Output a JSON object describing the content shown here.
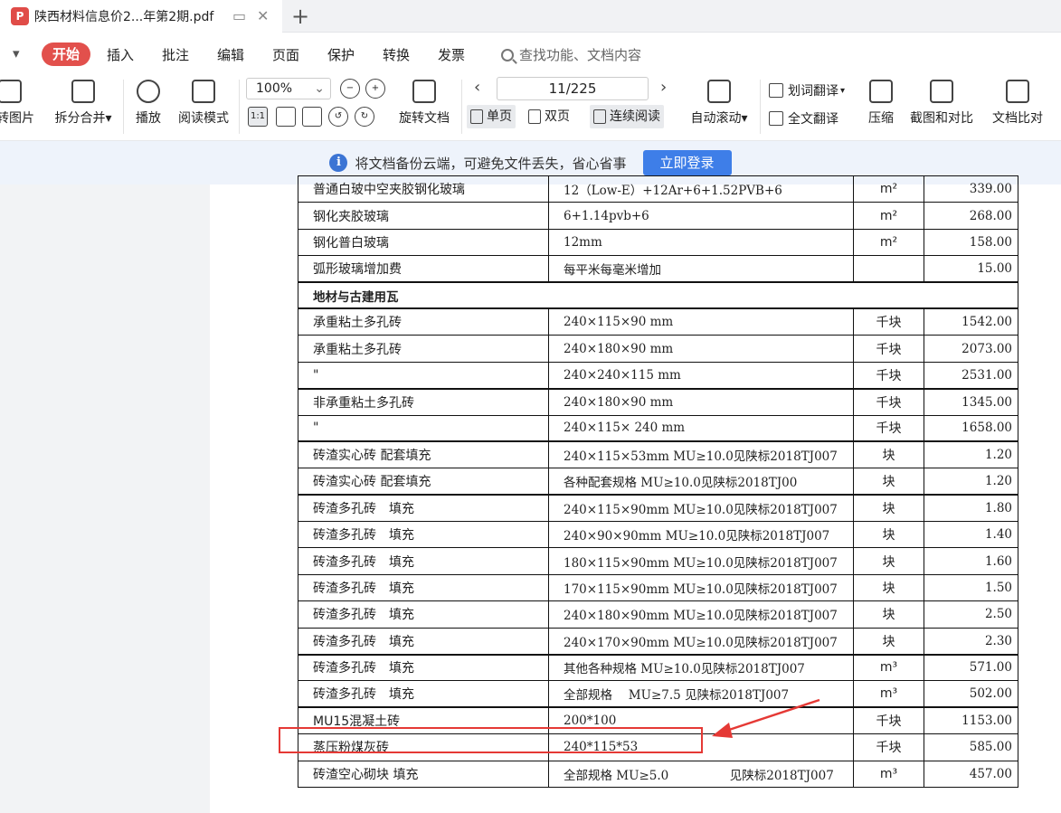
{
  "tab": {
    "title": "陕西材料信息价2...年第2期.pdf",
    "pdf_badge": "P"
  },
  "menu": {
    "dropdown": "▾",
    "active": "开始",
    "items": [
      "插入",
      "批注",
      "编辑",
      "页面",
      "保护",
      "转换",
      "发票"
    ],
    "search_placeholder": "查找功能、文档内容"
  },
  "toolbar": {
    "to_image": "转图片",
    "split_merge": "拆分合并",
    "play": "播放",
    "read_mode": "阅读模式",
    "zoom": "100%",
    "rotate": "旋转文档",
    "page_indicator": "11/225",
    "single_page": "单页",
    "double_page": "双页",
    "continuous": "连续阅读",
    "auto_scroll": "自动滚动",
    "word_translate": "划词翻译",
    "full_translate": "全文翻译",
    "compress": "压缩",
    "screenshot_compare": "截图和对比",
    "doc_compare": "文档比对"
  },
  "notice": {
    "text": "将文档备份云端，可避免文件丢失，省心省事",
    "button": "立即登录"
  },
  "table": {
    "rows": [
      [
        "普通白玻中空夹胶钢化玻璃",
        "12（Low-E）+12Ar+6+1.52PVB+6",
        "m²",
        "339.00"
      ],
      [
        "钢化夹胶玻璃",
        "6+1.14pvb+6",
        "m²",
        "268.00"
      ],
      [
        "钢化普白玻璃",
        "12mm",
        "m²",
        "158.00"
      ],
      [
        "弧形玻璃增加费",
        "每平米每毫米增加",
        "",
        "15.00"
      ],
      [
        "地材与古建用瓦"
      ],
      [
        "承重粘土多孔砖",
        "240×115×90 mm",
        "千块",
        "1542.00"
      ],
      [
        "承重粘土多孔砖",
        "240×180×90 mm",
        "千块",
        "2073.00"
      ],
      [
        "\"",
        "240×240×115 mm",
        "千块",
        "2531.00"
      ],
      [
        "非承重粘土多孔砖",
        "240×180×90 mm",
        "千块",
        "1345.00"
      ],
      [
        "\"",
        "240×115× 240 mm",
        "千块",
        "1658.00"
      ],
      [
        "砖渣实心砖 配套填充",
        "240×115×53mm MU≥10.0见陕标2018TJ007",
        "块",
        "1.20"
      ],
      [
        "砖渣实心砖 配套填充",
        "各种配套规格 MU≥10.0见陕标2018TJ00",
        "块",
        "1.20"
      ],
      [
        "砖渣多孔砖　填充",
        "240×115×90mm MU≥10.0见陕标2018TJ007",
        "块",
        "1.80"
      ],
      [
        "砖渣多孔砖　填充",
        "240×90×90mm MU≥10.0见陕标2018TJ007",
        "块",
        "1.40"
      ],
      [
        "砖渣多孔砖　填充",
        "180×115×90mm MU≥10.0见陕标2018TJ007",
        "块",
        "1.60"
      ],
      [
        "砖渣多孔砖　填充",
        "170×115×90mm MU≥10.0见陕标2018TJ007",
        "块",
        "1.50"
      ],
      [
        "砖渣多孔砖　填充",
        "240×180×90mm MU≥10.0见陕标2018TJ007",
        "块",
        "2.50"
      ],
      [
        "砖渣多孔砖　填充",
        "240×170×90mm MU≥10.0见陕标2018TJ007",
        "块",
        "2.30"
      ],
      [
        "砖渣多孔砖　填充",
        "其他各种规格 MU≥10.0见陕标2018TJ007",
        "m³",
        "571.00"
      ],
      [
        "砖渣多孔砖　填充",
        "全部规格　 MU≥7.5 见陕标2018TJ007",
        "m³",
        "502.00"
      ],
      [
        "MU15混凝土砖",
        "200*100",
        "千块",
        "1153.00"
      ],
      [
        "蒸压粉煤灰砖",
        "240*115*53",
        "千块",
        "585.00"
      ],
      [
        "砖渣空心砌块 填充",
        "全部规格 MU≥5.0　　　　　见陕标2018TJ007",
        "m³",
        "457.00"
      ]
    ]
  },
  "colors": {
    "accent_red": "#e2504c",
    "link_blue": "#3e7ee8",
    "annotation_red": "#e53935"
  }
}
